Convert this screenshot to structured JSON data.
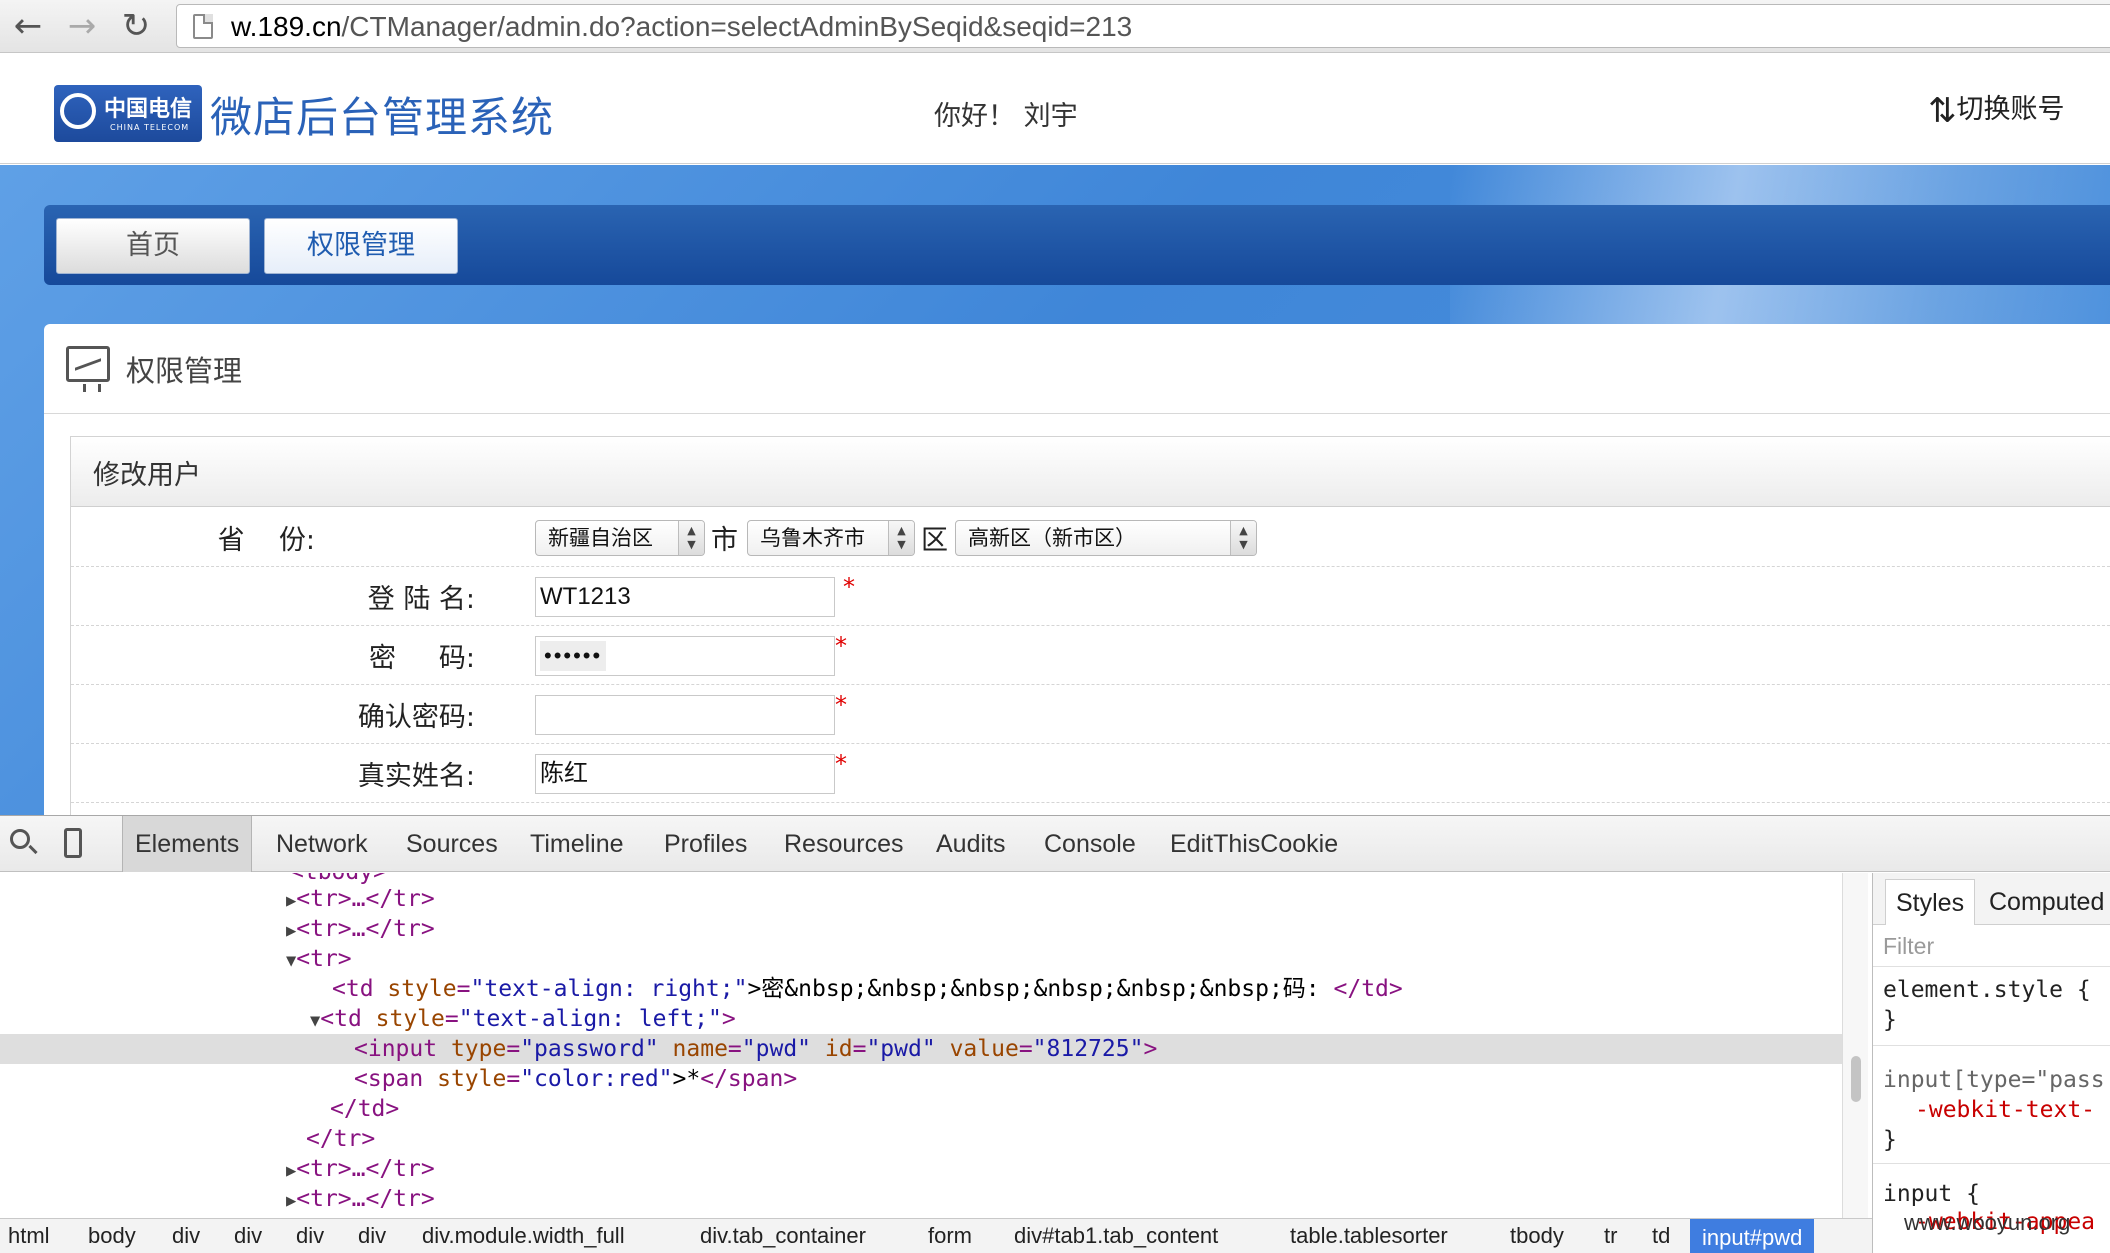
{
  "browser": {
    "back_icon": "←",
    "forward_icon": "→",
    "reload_icon": "↻",
    "url_host": "w.189.cn",
    "url_path": "/CTManager/admin.do?action=selectAdminBySeqid&seqid=213"
  },
  "header": {
    "logo_text_cn": "中国电信",
    "logo_text_en": "CHINA TELECOM",
    "system_title": "微店后台管理系统",
    "greeting": "你好！ 刘宇",
    "switch_account_label": "切换账号"
  },
  "nav": {
    "tabs": [
      {
        "label": "首页"
      },
      {
        "label": "权限管理"
      }
    ]
  },
  "panel": {
    "title": "权限管理",
    "subpanel_title": "修改用户"
  },
  "form": {
    "province_label": "省    份:",
    "province_value": "新疆自治区",
    "city_sep": "市",
    "city_value": "乌鲁木齐市",
    "district_sep": "区",
    "district_value": "高新区（新市区）",
    "login_label": "登 陆 名:",
    "login_value": "WT1213",
    "password_label": "密     码:",
    "password_value": "••••••",
    "confirm_label": "确认密码:",
    "confirm_value": "",
    "realname_label": "真实姓名:",
    "realname_value": "陈红",
    "required_mark": "*"
  },
  "devtools": {
    "tabs": [
      "Elements",
      "Network",
      "Sources",
      "Timeline",
      "Profiles",
      "Resources",
      "Audits",
      "Console",
      "EditThisCookie"
    ],
    "active_tab": "Elements",
    "code_lines": {
      "l0": "<tbody>",
      "l1": "<tr>…</tr>",
      "l2": "<tr>…</tr>",
      "l3": "<tr>",
      "l4_open": "<td ",
      "l4_attr": "style",
      "l4_val": "\"text-align: right;\"",
      "l4_text": ">密&nbsp;&nbsp;&nbsp;&nbsp;&nbsp;&nbsp;码: ",
      "l4_close": "</td>",
      "l5_open": "<td ",
      "l5_attr": "style",
      "l5_val": "\"text-align: left;\"",
      "l5_close": ">",
      "l6_tag": "<input ",
      "l6_a1": "type",
      "l6_v1": "\"password\"",
      "l6_a2": "name",
      "l6_v2": "\"pwd\"",
      "l6_a3": "id",
      "l6_v3": "\"pwd\"",
      "l6_a4": "value",
      "l6_v4": "\"812725\"",
      "l6_end": ">",
      "l7_open": "<span ",
      "l7_attr": "style",
      "l7_val": "\"color:red\"",
      "l7_text": ">*",
      "l7_close": "</span>",
      "l8": "</td>",
      "l9": "</tr>",
      "l10": "<tr>…</tr>",
      "l11": "<tr>…</tr>"
    },
    "sidebar": {
      "tabs": [
        "Styles",
        "Computed"
      ],
      "filter_placeholder": "Filter",
      "rule1_selector": "element.style {",
      "rule1_close": "}",
      "rule2_selector": "input[type=\"pass",
      "rule2_prop": "-webkit-text-",
      "rule2_close": "}",
      "rule3_selector": "input {",
      "rule3_prop": "-webkit-appea"
    },
    "breadcrumbs": [
      "html",
      "body",
      "div",
      "div",
      "div",
      "div",
      "div.module.width_full",
      "div.tab_container",
      "form",
      "div#tab1.tab_content",
      "table.tablesorter",
      "tbody",
      "tr",
      "td",
      "input#pwd"
    ]
  },
  "watermark": "www.wooyun.org"
}
